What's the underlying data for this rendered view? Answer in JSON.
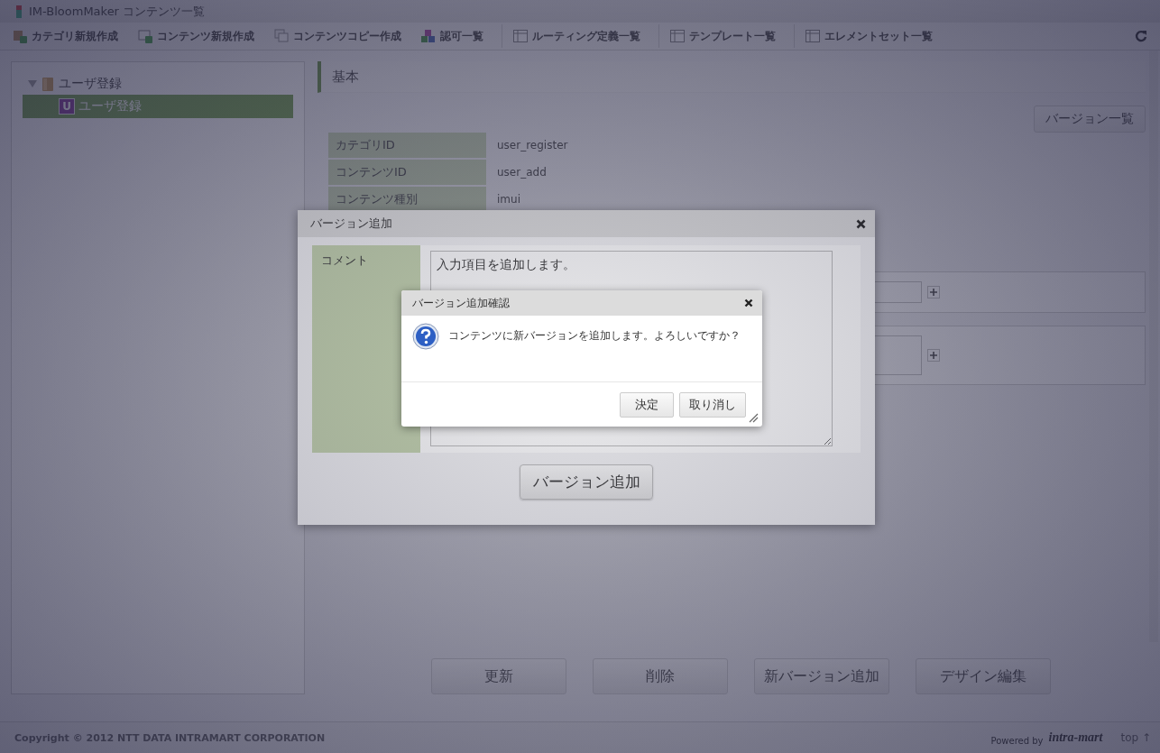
{
  "window": {
    "title": "IM-BloomMaker コンテンツ一覧"
  },
  "toolbar": [
    {
      "label": "カテゴリ新規作成",
      "kind": "category"
    },
    {
      "label": "コンテンツ新規作成",
      "kind": "content"
    },
    {
      "label": "コンテンツコピー作成",
      "kind": "copy"
    },
    {
      "label": "認可一覧",
      "kind": "permission"
    },
    {
      "label": "ルーティング定義一覧",
      "kind": "list"
    },
    {
      "label": "テンプレート一覧",
      "kind": "list"
    },
    {
      "label": "エレメントセット一覧",
      "kind": "list"
    }
  ],
  "tree": [
    {
      "label": "ユーザ登録",
      "expanded": true,
      "selected": false,
      "children": [
        {
          "label": "ユーザ登録",
          "badge": "U",
          "selected": true
        }
      ]
    }
  ],
  "section": {
    "title": "基本"
  },
  "version_list_button": "バージョン一覧",
  "properties": [
    {
      "label": "カテゴリID",
      "value": "user_register"
    },
    {
      "label": "コンテンツID",
      "value": "user_add"
    },
    {
      "label": "コンテンツ種別",
      "value": "imui"
    }
  ],
  "actions": [
    "更新",
    "削除",
    "新バージョン追加",
    "デザイン編集"
  ],
  "footer": {
    "copyright": "Copyright © 2012 NTT DATA INTRAMART CORPORATION",
    "powered_by": "Powered by",
    "logo": "intra-mart",
    "top_link": "top ↑"
  },
  "dialog": {
    "title": "バージョン追加",
    "comment_label": "コメント",
    "comment": "入力項目を追加します。",
    "submit": "バージョン追加"
  },
  "confirm": {
    "title": "バージョン追加確認",
    "message": "コンテンツに新バージョンを追加します。よろしいですか？",
    "buttons": [
      "決定",
      "取り消し"
    ]
  }
}
